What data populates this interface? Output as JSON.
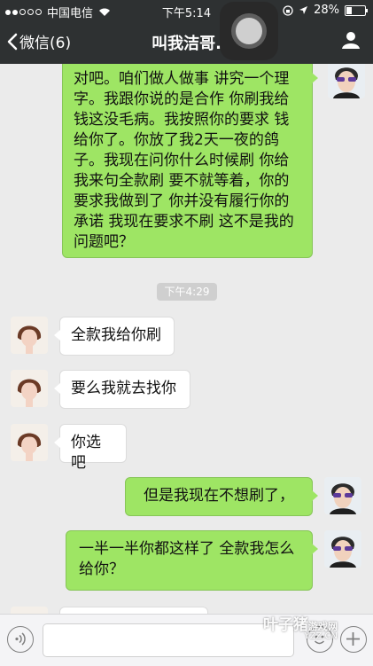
{
  "status_bar": {
    "carrier": "中国电信",
    "time": "下午5:14",
    "battery": "28%",
    "battery_level": 0.28
  },
  "nav": {
    "back_label": "微信(6)",
    "title": "叫我洁哥."
  },
  "messages": [
    {
      "side": "right",
      "text": "对吧。咱们做人做事 讲究一个理字。我跟你说的是合作 你刷我给钱这没毛病。我按照你的要求 钱给你了。你放了我2天一夜的鸽子。我现在问你什么时候刷 你给我来句全款刷 要不就等着，你的要求我做到了 你并没有履行你的承诺 我现在要求不刷 这不是我的问题吧？"
    },
    {
      "side": "left",
      "text": "全款我给你刷"
    },
    {
      "side": "left",
      "text": "要么我就去找你"
    },
    {
      "side": "left",
      "text": "你选吧"
    },
    {
      "side": "right",
      "text": "但是我现在不想刷了，"
    },
    {
      "side": "right",
      "text": "一半一半你都这样了 全款我怎么给你？"
    }
  ],
  "timestamp": "下午4:29",
  "watermark": {
    "main": "叶子猪",
    "sub": "游戏网",
    "url": "YZZ.CN"
  },
  "colors": {
    "nav_bg": "#2e3132",
    "chat_bg": "#ebebeb",
    "sent_bubble": "#9ee564",
    "received_bubble": "#ffffff"
  }
}
